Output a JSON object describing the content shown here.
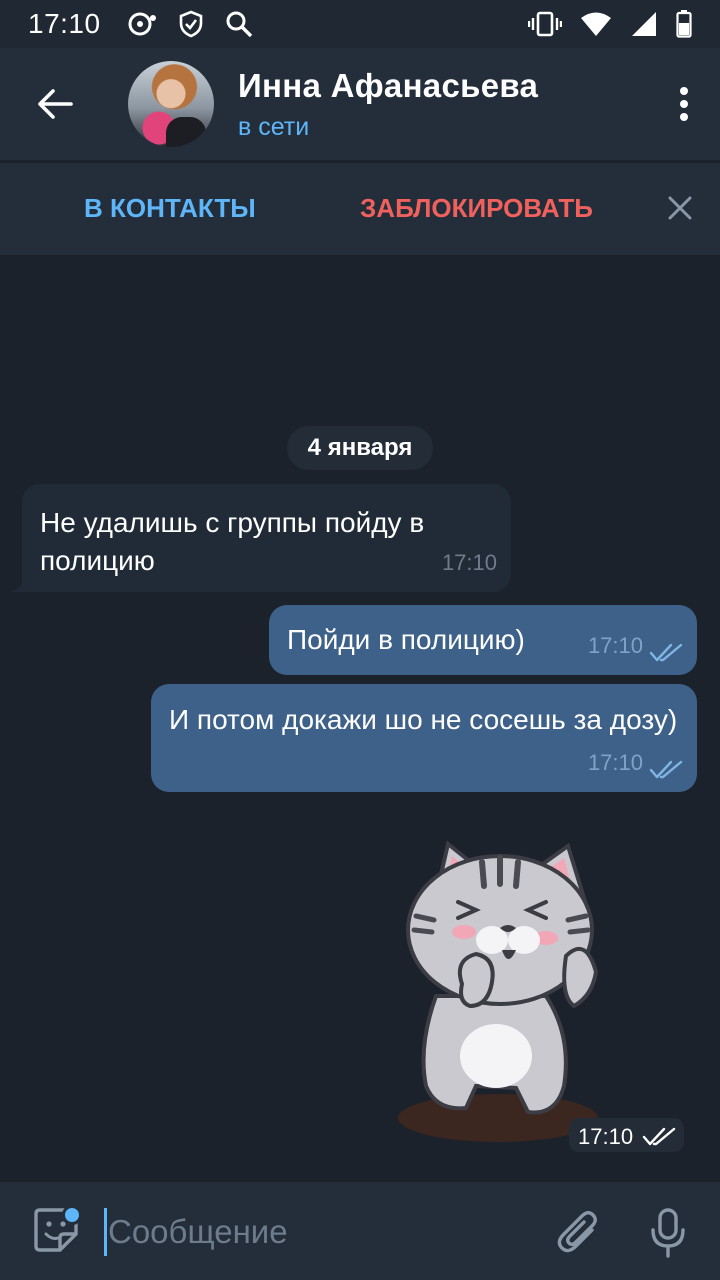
{
  "status_bar": {
    "time": "17:10"
  },
  "header": {
    "name": "Инна Афанасьева",
    "status": "в сети"
  },
  "action_bar": {
    "add_contact": "В КОНТАКТЫ",
    "block": "ЗАБЛОКИРОВАТЬ"
  },
  "chat": {
    "date": "4 января",
    "messages": [
      {
        "direction": "incoming",
        "text": "Не удалишь с группы пойду в полицию",
        "time": "17:10"
      },
      {
        "direction": "outgoing",
        "text": "Пойди в полицию)",
        "time": "17:10",
        "read": true
      },
      {
        "direction": "outgoing",
        "text": "И потом докажи шо не сосешь за дозу)",
        "time": "17:10",
        "read": true
      },
      {
        "direction": "outgoing",
        "type": "sticker",
        "sticker": "cat-thumbs-up",
        "time": "17:10",
        "read": true
      }
    ]
  },
  "input": {
    "placeholder": "Сообщение",
    "value": ""
  },
  "colors": {
    "background": "#1b222c",
    "header": "#242e3b",
    "accent": "#5eb5f7",
    "danger": "#f0615d",
    "incoming_bubble": "#212b37",
    "outgoing_bubble": "#3e6189"
  }
}
